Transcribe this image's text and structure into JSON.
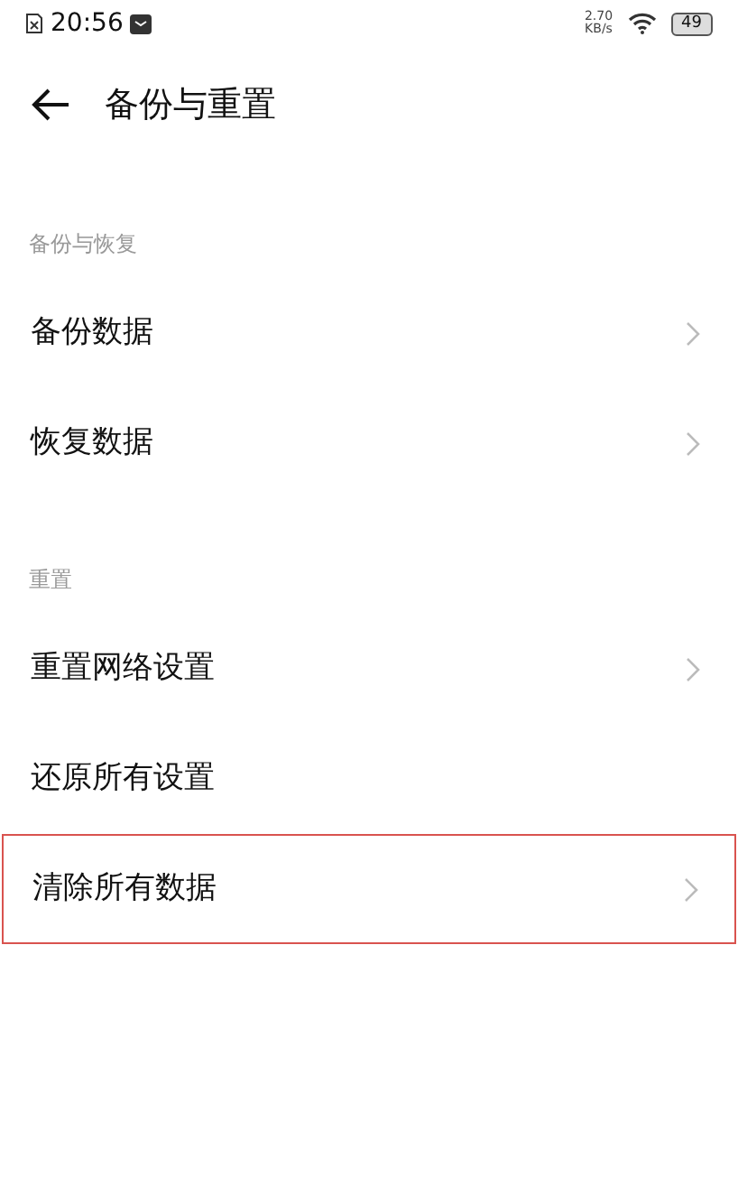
{
  "status_bar": {
    "time": "20:56",
    "speed": "2.70",
    "speed_unit": "KB/s",
    "battery": "49"
  },
  "header": {
    "title": "备份与重置"
  },
  "sections": [
    {
      "title": "备份与恢复",
      "items": [
        {
          "label": "备份数据",
          "chevron": true,
          "highlighted": false
        },
        {
          "label": "恢复数据",
          "chevron": true,
          "highlighted": false
        }
      ]
    },
    {
      "title": "重置",
      "items": [
        {
          "label": "重置网络设置",
          "chevron": true,
          "highlighted": false
        },
        {
          "label": "还原所有设置",
          "chevron": false,
          "highlighted": false
        },
        {
          "label": "清除所有数据",
          "chevron": true,
          "highlighted": true
        }
      ]
    }
  ]
}
